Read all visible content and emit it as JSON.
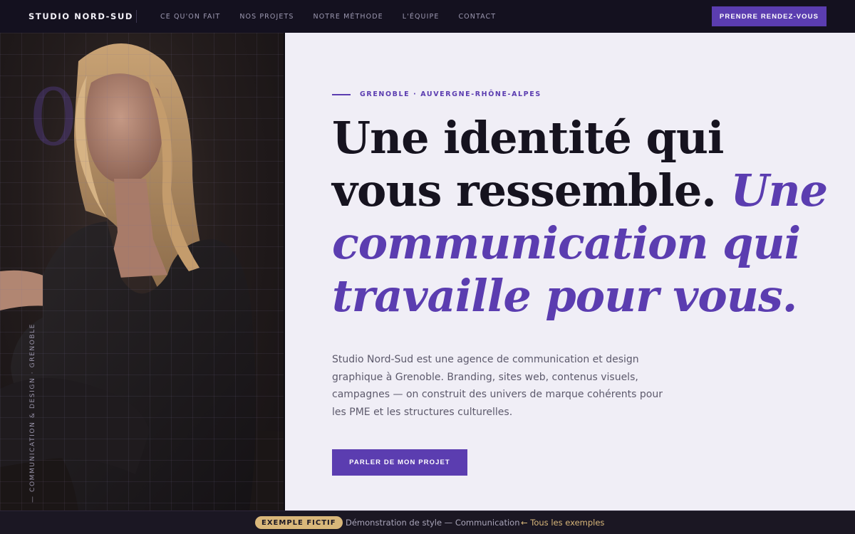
{
  "nav": {
    "brand": "STUDIO NORD-SUD",
    "links": [
      "CE QU'ON FAIT",
      "NOS PROJETS",
      "NOTRE MÉTHODE",
      "L'ÉQUIPE",
      "CONTACT"
    ],
    "cta": "PRENDRE RENDEZ-VOUS"
  },
  "photo": {
    "numeral": "0",
    "vertical_tag": "— COMMUNICATION & DESIGN · GRENOBLE"
  },
  "hero": {
    "eyebrow": "GRENOBLE · AUVERGNE-RHÔNE-ALPES",
    "headline_plain": "Une identité qui vous ressemble. ",
    "headline_accent": "Une communication qui travaille pour vous.",
    "intro": "Studio Nord-Sud est une agence de communication et design graphique à Grenoble. Branding, sites web, contenus visuels, campagnes — on construit des univers de marque cohérents pour les PME et les structures culturelles.",
    "cta": "PARLER DE MON PROJET"
  },
  "footer": {
    "badge": "EXEMPLE FICTIF",
    "demo": "Démonstration de style — Communication",
    "back": "← Tous les exemples"
  },
  "colors": {
    "accent": "#5b3db0",
    "nav_bg": "#14111f",
    "hero_bg": "#f0eef6",
    "badge": "#d9b77a"
  }
}
